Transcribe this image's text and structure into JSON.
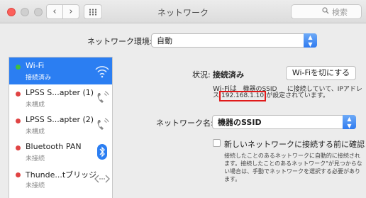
{
  "window": {
    "title": "ネットワーク",
    "search_placeholder": "検索",
    "search_icon": "magnifier-icon"
  },
  "location": {
    "label": "ネットワーク環境:",
    "value": "自動"
  },
  "services": [
    {
      "name": "Wi-Fi",
      "status": "接続済み",
      "dot_color": "#3fbf3f",
      "icon": "wifi-icon",
      "selected": true
    },
    {
      "name": "LPSS S...apter (1)",
      "status": "未構成",
      "dot_color": "#e04343",
      "icon": "phone-icon",
      "selected": false
    },
    {
      "name": "LPSS S...apter (2)",
      "status": "未構成",
      "dot_color": "#e04343",
      "icon": "phone-icon",
      "selected": false
    },
    {
      "name": "Bluetooth PAN",
      "status": "未接続",
      "dot_color": "#e04343",
      "icon": "bluetooth-icon",
      "selected": false
    },
    {
      "name": "Thunde...tブリッジ",
      "status": "未接続",
      "dot_color": "#e04343",
      "icon": "thunderbolt-bridge-icon",
      "selected": false
    }
  ],
  "status": {
    "label": "状況:",
    "value": "接続済み",
    "button": "Wi-Fiを切にする",
    "line1_a": "Wi-Fiは",
    "line1_ssid": "機器のSSID",
    "line1_b": "に接続していて、IPアドレ",
    "line2_a": "ス",
    "ip": "192.168.1.10",
    "line2_b": "が設定されています。"
  },
  "network_name": {
    "label": "ネットワーク名:",
    "value": "機器のSSID"
  },
  "ask_join": {
    "label": "新しいネットワークに接続する前に確認",
    "help_1": "接続したことのあるネットワークに自動的に接続され",
    "help_2": "ます。接続したことのあるネットワーク\"が見つからな",
    "help_3": "い場合は、手動でネットワークを選択する必要があり",
    "help_4": "ます。"
  }
}
